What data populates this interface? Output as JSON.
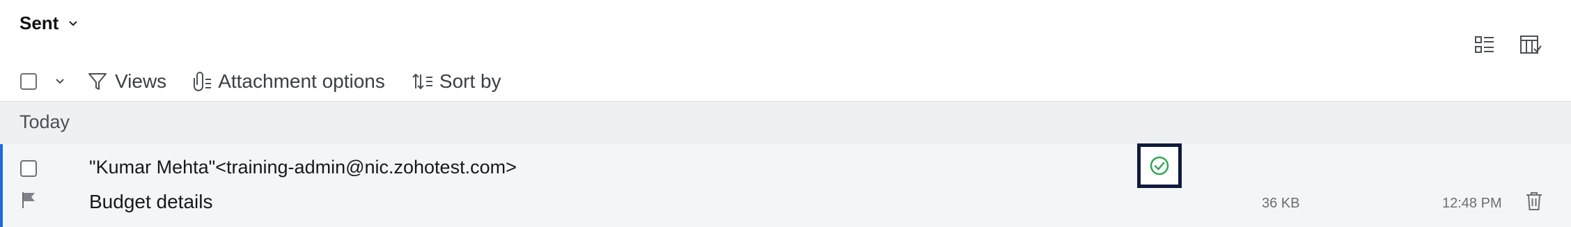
{
  "header": {
    "folder_name": "Sent",
    "folder_dropdown_icon": "chevron-down-icon",
    "view_icons": [
      "list-view-icon",
      "column-layout-icon"
    ]
  },
  "toolbar": {
    "select_all_icon": "checkbox-icon",
    "select_dropdown_icon": "chevron-down-icon",
    "views_label": "Views",
    "views_icon": "filter-icon",
    "attachment_label": "Attachment options",
    "attachment_icon": "paperclip-list-icon",
    "sort_label": "Sort by",
    "sort_icon": "sort-icon"
  },
  "group": {
    "label": "Today"
  },
  "messages": [
    {
      "sender": "\"Kumar Mehta\"<training-admin@nic.zohotest.com>",
      "subject": "Budget details",
      "size": "36 KB",
      "time": "12:48 PM",
      "status_icon": "check-circle-icon",
      "status_color": "#2fa84f",
      "flag_icon": "flag-icon",
      "delete_icon": "trash-icon"
    }
  ],
  "colors": {
    "accent": "#1a6be0",
    "group_background": "#eff0f2",
    "row_background": "#f4f5f6",
    "highlight_border": "#0f1a3d"
  }
}
